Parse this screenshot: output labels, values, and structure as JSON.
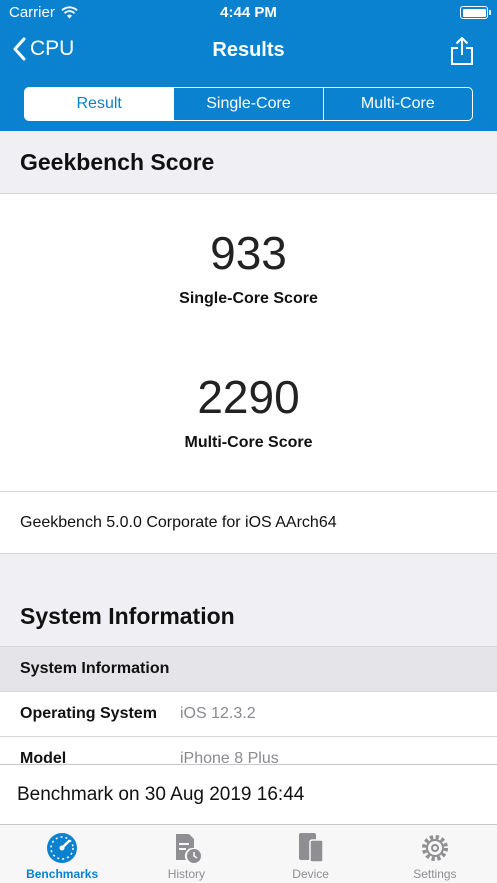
{
  "status": {
    "carrier": "Carrier",
    "time": "4:44 PM"
  },
  "nav": {
    "back_label": "CPU",
    "title": "Results"
  },
  "segments": [
    "Result",
    "Single-Core",
    "Multi-Core"
  ],
  "score_section": {
    "title": "Geekbench Score",
    "single_value": "933",
    "single_label": "Single-Core Score",
    "multi_value": "2290",
    "multi_label": "Multi-Core Score",
    "version": "Geekbench 5.0.0 Corporate for iOS AArch64"
  },
  "system": {
    "title": "System Information",
    "subheader": "System Information",
    "rows": [
      {
        "key": "Operating System",
        "value": "iOS 12.3.2"
      },
      {
        "key": "Model",
        "value": "iPhone 8 Plus"
      }
    ]
  },
  "footer": "Benchmark on 30 Aug 2019 16:44",
  "tabs": [
    {
      "label": "Benchmarks",
      "icon": "gauge-icon",
      "active": true
    },
    {
      "label": "History",
      "icon": "history-icon",
      "active": false
    },
    {
      "label": "Device",
      "icon": "device-icon",
      "active": false
    },
    {
      "label": "Settings",
      "icon": "gear-icon",
      "active": false
    }
  ],
  "colors": {
    "accent": "#0a82d0",
    "background": "#efeff4",
    "inactive": "#8e8e93"
  }
}
